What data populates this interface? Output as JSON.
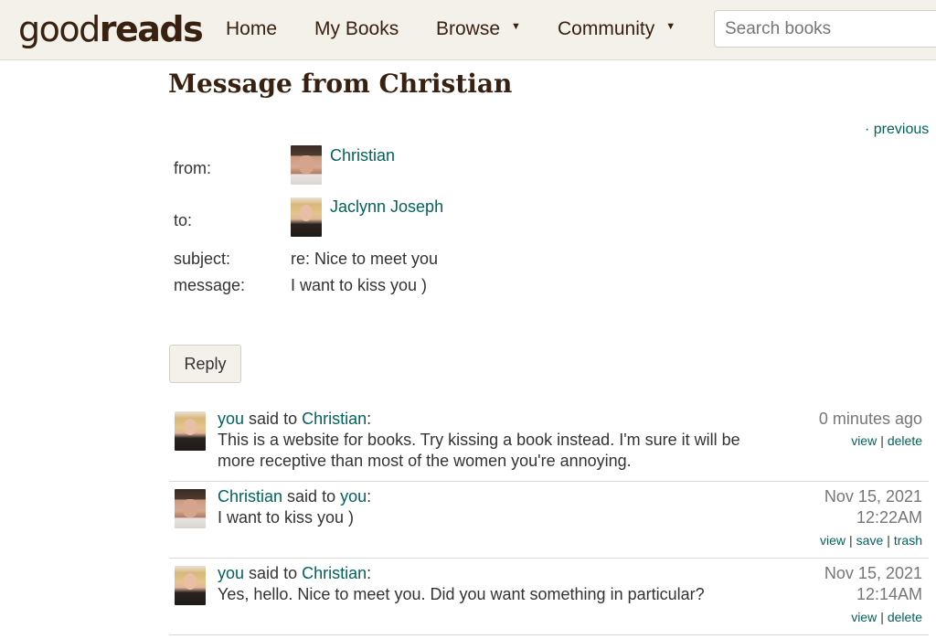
{
  "header": {
    "logo_part1": "good",
    "logo_part2": "reads",
    "nav": {
      "home": "Home",
      "my_books": "My Books",
      "browse": "Browse",
      "community": "Community"
    },
    "search_placeholder": "Search books"
  },
  "page": {
    "title": "Message from Christian",
    "previous_link": "· previous"
  },
  "message": {
    "from_label": "from:",
    "from_name": "Christian",
    "to_label": "to:",
    "to_name": "Jaclynn Joseph",
    "subject_label": "subject:",
    "subject_value": "re: Nice to meet you",
    "message_label": "message:",
    "message_value": "I want to kiss you )",
    "reply_button": "Reply"
  },
  "thread": [
    {
      "speaker": "you",
      "said_to": "said to",
      "recipient": "Christian",
      "colon": ":",
      "body": "This is a website for books. Try kissing a book instead. I'm sure it will be more receptive than most of the women you're annoying.",
      "time_line1": "0 minutes ago",
      "time_line2": "",
      "actions": [
        "view",
        "delete"
      ]
    },
    {
      "speaker": "Christian",
      "said_to": "said to",
      "recipient": "you",
      "colon": ":",
      "body": "I want to kiss you )",
      "time_line1": "Nov 15, 2021",
      "time_line2": "12:22AM",
      "actions": [
        "view",
        "save",
        "trash"
      ]
    },
    {
      "speaker": "you",
      "said_to": "said to",
      "recipient": "Christian",
      "colon": ":",
      "body": "Yes, hello. Nice to meet you. Did you want something in particular?",
      "time_line1": "Nov 15, 2021",
      "time_line2": "12:14AM",
      "actions": [
        "view",
        "delete"
      ]
    }
  ],
  "colors": {
    "header_bg": "#f4f1ea",
    "link": "#00635d",
    "brand_dark": "#382110",
    "muted": "#767676"
  }
}
